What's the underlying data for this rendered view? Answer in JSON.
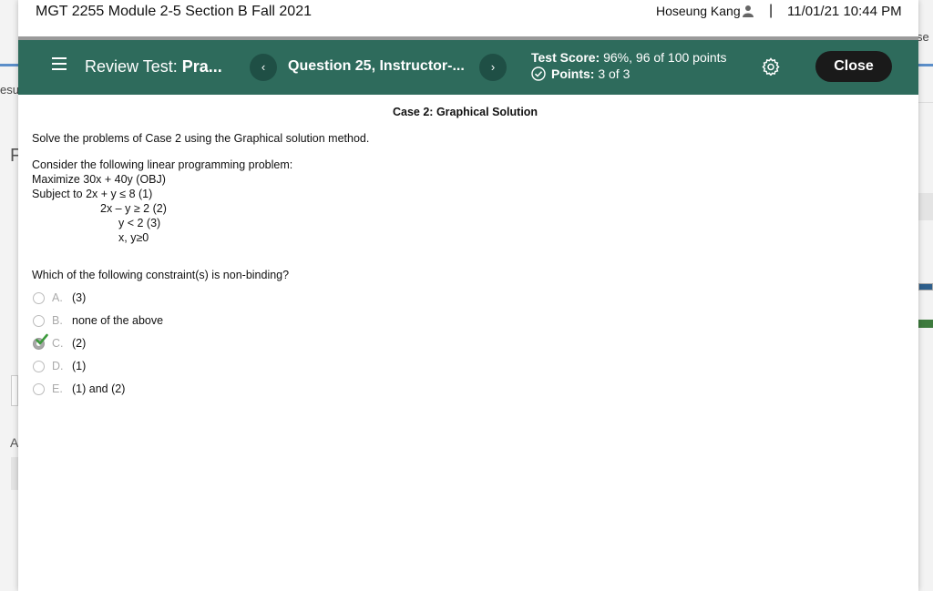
{
  "background": {
    "left_text": "esu",
    "right_text": "se",
    "letter_f": "F",
    "letter_a": "A"
  },
  "topbar": {
    "course_title": "MGT 2255 Module 2-5 Section B Fall 2021",
    "user_name": "Hoseung Kang",
    "separator": "|",
    "datetime": "11/01/21 10:44 PM"
  },
  "navbar": {
    "review_prefix": "Review Test:",
    "review_name": "Pra...",
    "prev_label": "‹",
    "next_label": "›",
    "question_label": "Question 25, Instructor-...",
    "score_label": "Test Score:",
    "score_value": "96%, 96 of 100 points",
    "points_label": "Points:",
    "points_value": "3 of 3",
    "close_label": "Close"
  },
  "question": {
    "case_title": "Case 2: Graphical Solution",
    "instruction": "Solve the problems of Case 2 using the Graphical solution method.",
    "lp_intro": "Consider the following linear programming problem:",
    "objective": "Maximize 30x + 40y (OBJ)",
    "constraint_1": "Subject to 2x + y ≤  8 (1)",
    "constraint_2": "2x – y ≥  2 (2)",
    "constraint_3": "y  <  2 (3)",
    "nonneg": "x, y≥0",
    "prompt": "Which of the following constraint(s) is non-binding?",
    "options": [
      {
        "letter": "A.",
        "text": "(3)",
        "selected": false
      },
      {
        "letter": "B.",
        "text": "none of the above",
        "selected": false
      },
      {
        "letter": "C.",
        "text": "(2)",
        "selected": true
      },
      {
        "letter": "D.",
        "text": "(1)",
        "selected": false
      },
      {
        "letter": "E.",
        "text": "(1) and (2)",
        "selected": false
      }
    ]
  },
  "colors": {
    "navbar": "#2e6b5c",
    "nav_button": "#1f4f45",
    "close_button": "#1a1a1a",
    "correct_check": "#3c9a3c"
  }
}
